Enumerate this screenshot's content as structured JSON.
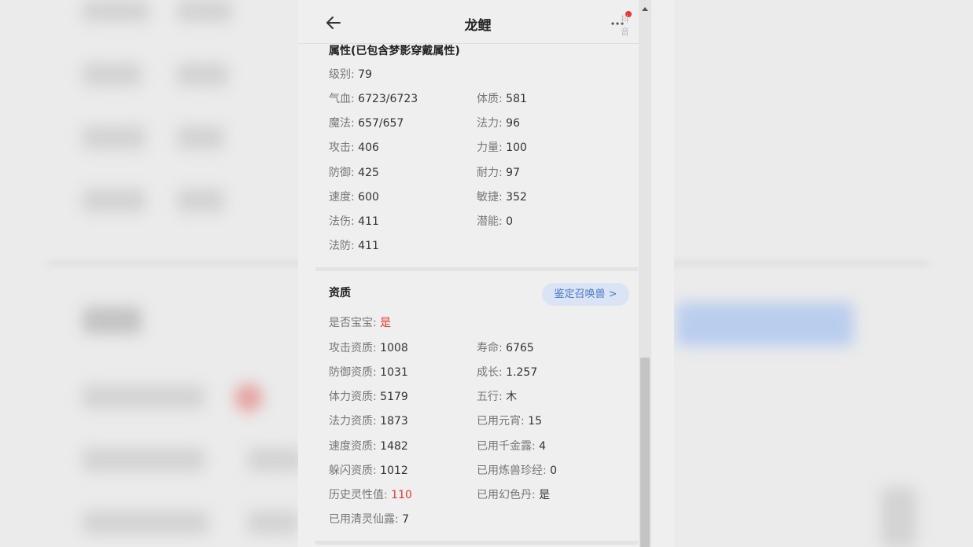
{
  "header": {
    "title": "龙鲤",
    "watermark": "抖音",
    "icons": {
      "back": "arrow-left-icon",
      "more": "more-icon"
    }
  },
  "attributes": {
    "title": "属性(已包含梦影穿戴属性)",
    "level": {
      "label": "级别:",
      "value": "79"
    },
    "left": [
      {
        "label": "气血:",
        "value": "6723/6723"
      },
      {
        "label": "魔法:",
        "value": "657/657"
      },
      {
        "label": "攻击:",
        "value": "406"
      },
      {
        "label": "防御:",
        "value": "425"
      },
      {
        "label": "速度:",
        "value": "600"
      },
      {
        "label": "法伤:",
        "value": "411"
      },
      {
        "label": "法防:",
        "value": "411"
      }
    ],
    "right": [
      {
        "label": "体质:",
        "value": "581"
      },
      {
        "label": "法力:",
        "value": "96"
      },
      {
        "label": "力量:",
        "value": "100"
      },
      {
        "label": "耐力:",
        "value": "97"
      },
      {
        "label": "敏捷:",
        "value": "352"
      },
      {
        "label": "潜能:",
        "value": "0"
      }
    ]
  },
  "aptitude": {
    "title": "资质",
    "appraise_button": "鉴定召唤兽 >",
    "is_baby": {
      "label": "是否宝宝:",
      "value": "是"
    },
    "left": [
      {
        "label": "攻击资质:",
        "value": "1008"
      },
      {
        "label": "防御资质:",
        "value": "1031"
      },
      {
        "label": "体力资质:",
        "value": "5179"
      },
      {
        "label": "法力资质:",
        "value": "1873"
      },
      {
        "label": "速度资质:",
        "value": "1482"
      },
      {
        "label": "躲闪资质:",
        "value": "1012"
      },
      {
        "label": "历史灵性值:",
        "value": "110"
      },
      {
        "label": "已用清灵仙露:",
        "value": "7"
      }
    ],
    "right": [
      {
        "label": "寿命:",
        "value": "6765"
      },
      {
        "label": "成长:",
        "value": "1.257"
      },
      {
        "label": "五行:",
        "value": "木"
      },
      {
        "label": "已用元宵:",
        "value": "15"
      },
      {
        "label": "已用千金露:",
        "value": "4"
      },
      {
        "label": "已用炼兽珍经:",
        "value": "0"
      },
      {
        "label": "已用幻色丹:",
        "value": "是"
      }
    ]
  },
  "colors": {
    "accent": "#4a78c9",
    "highlight": "#e53935",
    "panel_bg": "#efefef"
  }
}
